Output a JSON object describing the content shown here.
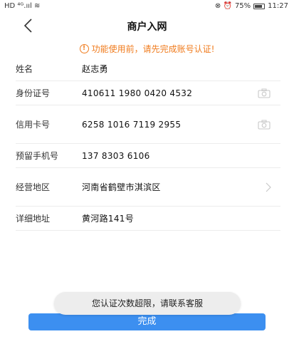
{
  "status_bar": {
    "left_icons": "HD ⁴ᴳ.ııl ≋",
    "right_icons": "⊗ ⏰",
    "battery": "75%",
    "time": "11:27"
  },
  "nav": {
    "back_icon": "chevron-left-icon",
    "title": "商户入网"
  },
  "warning": {
    "icon": "info-circle-icon",
    "text": "功能使用前，请先完成账号认证!",
    "color": "#f07c1e"
  },
  "form": {
    "rows": [
      {
        "label": "姓名",
        "value": "赵志勇"
      },
      {
        "label": "身份证号",
        "value": "410611 1980 0420 4532",
        "icon": "camera-icon"
      },
      {
        "label": "信用卡号",
        "value": "6258 1016 7119 2955",
        "icon": "camera-icon"
      },
      {
        "label": "预留手机号",
        "value": "137 8303 6106"
      },
      {
        "label": "经营地区",
        "value": "河南省鹤壁市淇滨区",
        "icon": "chevron-right-icon"
      },
      {
        "label": "详细地址",
        "value": "黄河路141号"
      }
    ]
  },
  "toast": {
    "text": "您认证次数超限，请联系客服"
  },
  "submit": {
    "label": "完成",
    "color": "#3c8ff0"
  }
}
